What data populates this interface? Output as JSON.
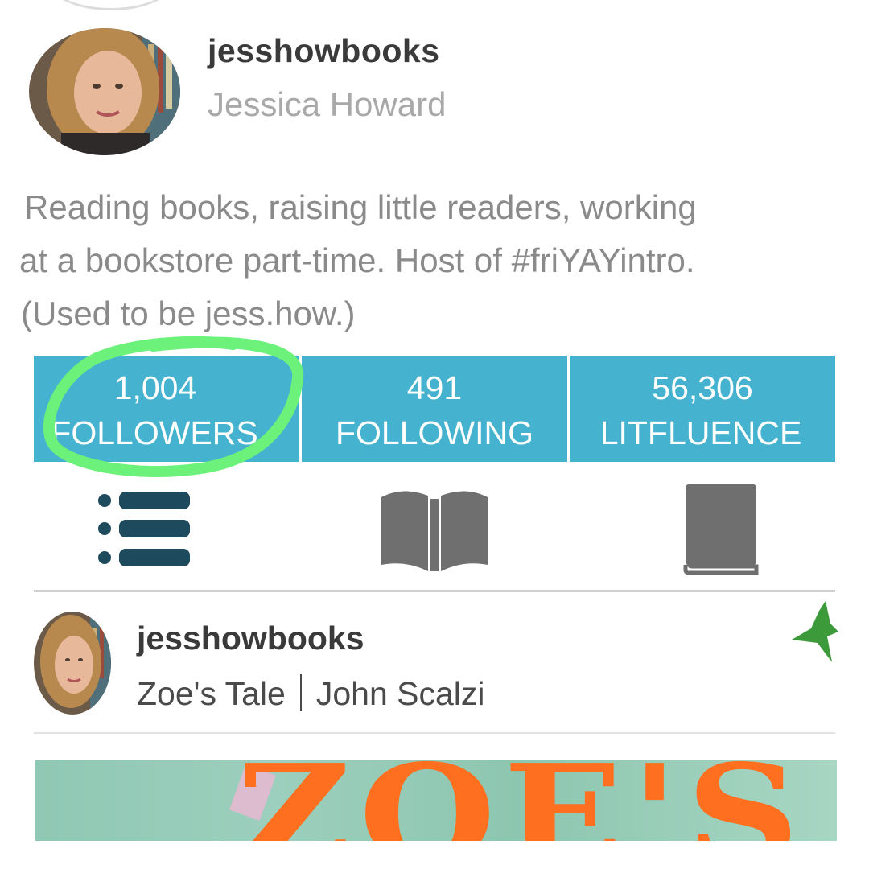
{
  "profile": {
    "username": "jesshowbooks",
    "full_name": "Jessica Howard",
    "bio_lines": [
      "Reading books, raising little readers, working",
      "at a bookstore part-time. Host of #friYAYintro.",
      "(Used to be jess.how.)"
    ]
  },
  "stats": [
    {
      "count": "1,004",
      "label": "FOLLOWERS"
    },
    {
      "count": "491",
      "label": "FOLLOWING"
    },
    {
      "count": "56,306",
      "label": "LITFLUENCE"
    }
  ],
  "tabs": [
    {
      "icon": "list-icon",
      "active": true
    },
    {
      "icon": "open-book-icon",
      "active": false
    },
    {
      "icon": "closed-book-icon",
      "active": false
    }
  ],
  "feed": [
    {
      "username": "jesshowbooks",
      "book_title": "Zoe's Tale",
      "author": "John Scalzi",
      "icon": "star-icon",
      "cover_title": "ZOE'S"
    }
  ],
  "colors": {
    "stats_bar": "#45b3cf",
    "highlight": "#6cf27a",
    "active_tab": "#1d4a5c",
    "inactive_tab": "#6f6f6f",
    "star": "#3d9a3a",
    "cover_title": "#ff6f1f"
  }
}
